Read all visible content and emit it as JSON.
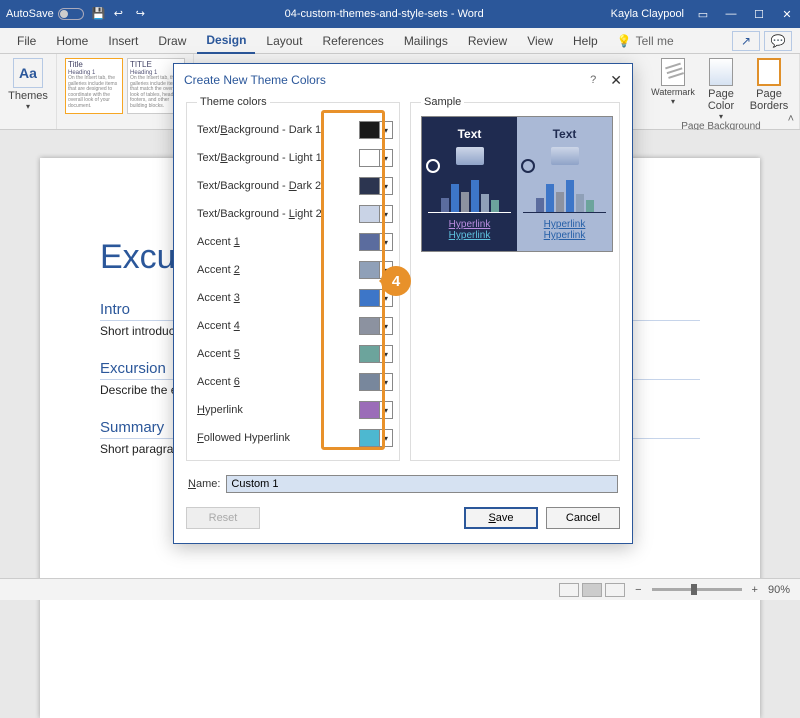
{
  "titlebar": {
    "autosave": "AutoSave",
    "docname": "04-custom-themes-and-style-sets - Word",
    "username": "Kayla Claypool"
  },
  "tabs": [
    "File",
    "Home",
    "Insert",
    "Draw",
    "Design",
    "Layout",
    "References",
    "Mailings",
    "Review",
    "View",
    "Help"
  ],
  "active_tab": "Design",
  "tell_me": "Tell me",
  "ribbon": {
    "themes_label": "Themes",
    "gallery": [
      {
        "title": "Title",
        "sub": "Heading 1",
        "body": "On the Insert tab, the galleries include items that are designed to coordinate with the overall look of your document."
      },
      {
        "title": "TITLE",
        "sub": "Heading 1",
        "body": "On the Insert tab, the galleries include items that match the overall look of tables, headers, footers, and other building blocks."
      }
    ],
    "page_bg": {
      "watermark": "Watermark",
      "page_color": "Page Color",
      "page_borders": "Page Borders",
      "group": "Page Background"
    }
  },
  "doc": {
    "h1": "Excursion Title",
    "s1_h": "Intro",
    "s1_p": "Short introduction",
    "s2_h": "Excursion",
    "s2_p": "Describe the excursion",
    "s3_h": "Summary",
    "s3_p": "Short paragraph"
  },
  "dialog": {
    "title": "Create New Theme Colors",
    "legend_colors": "Theme colors",
    "legend_sample": "Sample",
    "rows": [
      {
        "label": "Text/Background - Dark 1",
        "u": "B",
        "color": "#1a1a1a"
      },
      {
        "label": "Text/Background - Light 1",
        "u": "B",
        "color": "#ffffff"
      },
      {
        "label": "Text/Background - Dark 2",
        "u": "D",
        "color": "#2c3550"
      },
      {
        "label": "Text/Background - Light 2",
        "u": "L",
        "color": "#c9d3e6"
      },
      {
        "label": "Accent 1",
        "u": "1",
        "color": "#5b6c9e"
      },
      {
        "label": "Accent 2",
        "u": "2",
        "color": "#8fa0b8"
      },
      {
        "label": "Accent 3",
        "u": "3",
        "color": "#3d76c8"
      },
      {
        "label": "Accent 4",
        "u": "4",
        "color": "#8c92a0"
      },
      {
        "label": "Accent 5",
        "u": "5",
        "color": "#6ca49c"
      },
      {
        "label": "Accent 6",
        "u": "6",
        "color": "#78879c"
      },
      {
        "label": "Hyperlink",
        "u": "H",
        "color": "#9b6db8"
      },
      {
        "label": "Followed Hyperlink",
        "u": "F",
        "color": "#4db8d0"
      }
    ],
    "sample": {
      "text": "Text",
      "hyperlink": "Hyperlink",
      "bars": [
        14,
        28,
        20,
        32,
        18,
        12
      ]
    },
    "name_label": "Name:",
    "name_value": "Custom 1",
    "reset": "Reset",
    "save": "Save",
    "cancel": "Cancel",
    "callout": "4"
  },
  "statusbar": {
    "zoom": "90%"
  },
  "colors": {
    "bar_palette": [
      "#5b6c9e",
      "#3d76c8",
      "#8c92a0",
      "#3d76c8",
      "#8fa0b8",
      "#6ca49c"
    ]
  }
}
